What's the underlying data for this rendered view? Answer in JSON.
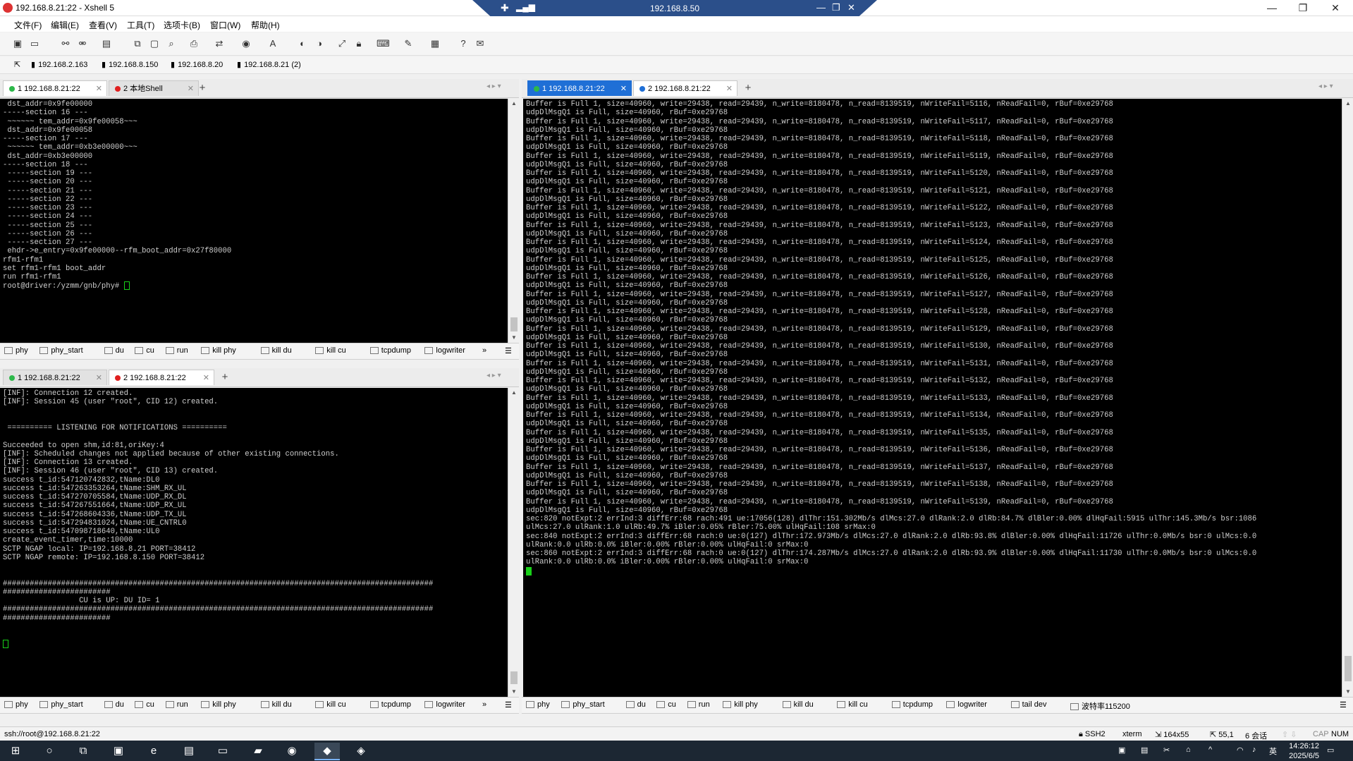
{
  "window": {
    "title": "192.168.8.21:22 - Xshell 5",
    "controls": [
      "—",
      "❐",
      "✕"
    ]
  },
  "remote_bar": {
    "title": "192.168.8.50",
    "controls": [
      "—",
      "❐",
      "✕"
    ]
  },
  "menu": [
    "文件(F)",
    "编辑(E)",
    "查看(V)",
    "工具(T)",
    "选项卡(B)",
    "窗口(W)",
    "帮助(H)"
  ],
  "toolbar_icons": [
    "new-session-icon",
    "open-icon",
    "connect-icon",
    "disconnect-icon",
    "properties-icon",
    "copy-icon",
    "paste-icon",
    "find-icon",
    "print-icon",
    "transfer-icon",
    "globe-icon",
    "font-icon",
    "xftp-icon",
    "xmanager-icon",
    "fullscreen-icon",
    "lock-icon",
    "keyboard-icon",
    "compose-icon",
    "layout-icon",
    "help-icon",
    "chat-icon"
  ],
  "bookmarks": [
    "192.168.2.163",
    "192.168.8.150",
    "192.168.8.20",
    "192.168.8.21 (2)"
  ],
  "top_left": {
    "tabs": [
      {
        "label": "1 192.168.8.21:22",
        "dot": "#2db84a"
      },
      {
        "label": "2 本地Shell",
        "dot": "#e02020"
      }
    ],
    "lines": [
      " dst_addr=0x9fe00000",
      "-----section 16 ---",
      " ~~~~~~ tem_addr=0x9fe00058~~~",
      " dst_addr=0x9fe00058",
      "-----section 17 ---",
      " ~~~~~~ tem_addr=0xb3e00000~~~",
      " dst_addr=0xb3e00000",
      "-----section 18 ---",
      " -----section 19 ---",
      " -----section 20 ---",
      " -----section 21 ---",
      " -----section 22 ---",
      " -----section 23 ---",
      " -----section 24 ---",
      " -----section 25 ---",
      " -----section 26 ---",
      " -----section 27 ---",
      " ehdr->e_entry=0x9fe00000--rfm_boot_addr=0x27f80000",
      "rfm1-rfm1",
      "set rfm1-rfm1 boot_addr",
      "run rfm1-rfm1",
      "root@driver:/yzmm/gnb/phy# "
    ]
  },
  "bottom_left": {
    "tabs": [
      {
        "label": "1 192.168.8.21:22",
        "dot": "#2db84a"
      },
      {
        "label": "2 192.168.8.21:22",
        "dot": "#e02020"
      }
    ],
    "lines": [
      "[INF]: Connection 12 created.",
      "[INF]: Session 45 (user \"root\", CID 12) created.",
      "",
      "",
      " ========== LISTENING FOR NOTIFICATIONS ==========",
      "",
      "Succeeded to open shm,id:81,oriKey:4",
      "[INF]: Scheduled changes not applied because of other existing connections.",
      "[INF]: Connection 13 created.",
      "[INF]: Session 46 (user \"root\", CID 13) created.",
      "success t_id:547120742832,tName:DL0",
      "success t_id:547263353264,tName:SHM_RX_UL",
      "success t_id:547270705584,tName:UDP_RX_DL",
      "success t_id:547267551664,tName:UDP_RX_UL",
      "success t_id:547268604336,tName:UDP_TX_UL",
      "success t_id:547294831024,tName:UE_CNTRL0",
      "success t_id:547098718640,tName:UL0",
      "create_event_timer,time:10000",
      "SCTP NGAP local: IP=192.168.8.21 PORT=38412",
      "SCTP NGAP remote: IP=192.168.8.150 PORT=38412",
      "",
      "",
      "################################################################################################",
      "########################",
      "                 CU is UP: DU ID= 1",
      "################################################################################################",
      "########################",
      "",
      ""
    ]
  },
  "right": {
    "tabs": [
      {
        "label": "1 192.168.8.21:22",
        "dot": "#2db84a"
      },
      {
        "label": "2 192.168.8.21:22",
        "dot": "#1f6fd6"
      }
    ],
    "lines": [
      "Buffer is Full 1, size=40960, write=29438, read=29439, n_write=8180478, n_read=8139519, nWriteFail=5116, nReadFail=0, rBuf=0xe29768",
      "udpDlMsgQ1 is Full, size=40960, rBuf=0xe29768",
      "Buffer is Full 1, size=40960, write=29438, read=29439, n_write=8180478, n_read=8139519, nWriteFail=5117, nReadFail=0, rBuf=0xe29768",
      "udpDlMsgQ1 is Full, size=40960, rBuf=0xe29768",
      "Buffer is Full 1, size=40960, write=29438, read=29439, n_write=8180478, n_read=8139519, nWriteFail=5118, nReadFail=0, rBuf=0xe29768",
      "udpDlMsgQ1 is Full, size=40960, rBuf=0xe29768",
      "Buffer is Full 1, size=40960, write=29438, read=29439, n_write=8180478, n_read=8139519, nWriteFail=5119, nReadFail=0, rBuf=0xe29768",
      "udpDlMsgQ1 is Full, size=40960, rBuf=0xe29768",
      "Buffer is Full 1, size=40960, write=29438, read=29439, n_write=8180478, n_read=8139519, nWriteFail=5120, nReadFail=0, rBuf=0xe29768",
      "udpDlMsgQ1 is Full, size=40960, rBuf=0xe29768",
      "Buffer is Full 1, size=40960, write=29438, read=29439, n_write=8180478, n_read=8139519, nWriteFail=5121, nReadFail=0, rBuf=0xe29768",
      "udpDlMsgQ1 is Full, size=40960, rBuf=0xe29768",
      "Buffer is Full 1, size=40960, write=29438, read=29439, n_write=8180478, n_read=8139519, nWriteFail=5122, nReadFail=0, rBuf=0xe29768",
      "udpDlMsgQ1 is Full, size=40960, rBuf=0xe29768",
      "Buffer is Full 1, size=40960, write=29438, read=29439, n_write=8180478, n_read=8139519, nWriteFail=5123, nReadFail=0, rBuf=0xe29768",
      "udpDlMsgQ1 is Full, size=40960, rBuf=0xe29768",
      "Buffer is Full 1, size=40960, write=29438, read=29439, n_write=8180478, n_read=8139519, nWriteFail=5124, nReadFail=0, rBuf=0xe29768",
      "udpDlMsgQ1 is Full, size=40960, rBuf=0xe29768",
      "Buffer is Full 1, size=40960, write=29438, read=29439, n_write=8180478, n_read=8139519, nWriteFail=5125, nReadFail=0, rBuf=0xe29768",
      "udpDlMsgQ1 is Full, size=40960, rBuf=0xe29768",
      "Buffer is Full 1, size=40960, write=29438, read=29439, n_write=8180478, n_read=8139519, nWriteFail=5126, nReadFail=0, rBuf=0xe29768",
      "udpDlMsgQ1 is Full, size=40960, rBuf=0xe29768",
      "Buffer is Full 1, size=40960, write=29438, read=29439, n_write=8180478, n_read=8139519, nWriteFail=5127, nReadFail=0, rBuf=0xe29768",
      "udpDlMsgQ1 is Full, size=40960, rBuf=0xe29768",
      "Buffer is Full 1, size=40960, write=29438, read=29439, n_write=8180478, n_read=8139519, nWriteFail=5128, nReadFail=0, rBuf=0xe29768",
      "udpDlMsgQ1 is Full, size=40960, rBuf=0xe29768",
      "Buffer is Full 1, size=40960, write=29438, read=29439, n_write=8180478, n_read=8139519, nWriteFail=5129, nReadFail=0, rBuf=0xe29768",
      "udpDlMsgQ1 is Full, size=40960, rBuf=0xe29768",
      "Buffer is Full 1, size=40960, write=29438, read=29439, n_write=8180478, n_read=8139519, nWriteFail=5130, nReadFail=0, rBuf=0xe29768",
      "udpDlMsgQ1 is Full, size=40960, rBuf=0xe29768",
      "Buffer is Full 1, size=40960, write=29438, read=29439, n_write=8180478, n_read=8139519, nWriteFail=5131, nReadFail=0, rBuf=0xe29768",
      "udpDlMsgQ1 is Full, size=40960, rBuf=0xe29768",
      "Buffer is Full 1, size=40960, write=29438, read=29439, n_write=8180478, n_read=8139519, nWriteFail=5132, nReadFail=0, rBuf=0xe29768",
      "udpDlMsgQ1 is Full, size=40960, rBuf=0xe29768",
      "Buffer is Full 1, size=40960, write=29438, read=29439, n_write=8180478, n_read=8139519, nWriteFail=5133, nReadFail=0, rBuf=0xe29768",
      "udpDlMsgQ1 is Full, size=40960, rBuf=0xe29768",
      "Buffer is Full 1, size=40960, write=29438, read=29439, n_write=8180478, n_read=8139519, nWriteFail=5134, nReadFail=0, rBuf=0xe29768",
      "udpDlMsgQ1 is Full, size=40960, rBuf=0xe29768",
      "Buffer is Full 1, size=40960, write=29438, read=29439, n_write=8180478, n_read=8139519, nWriteFail=5135, nReadFail=0, rBuf=0xe29768",
      "udpDlMsgQ1 is Full, size=40960, rBuf=0xe29768",
      "Buffer is Full 1, size=40960, write=29438, read=29439, n_write=8180478, n_read=8139519, nWriteFail=5136, nReadFail=0, rBuf=0xe29768",
      "udpDlMsgQ1 is Full, size=40960, rBuf=0xe29768",
      "Buffer is Full 1, size=40960, write=29438, read=29439, n_write=8180478, n_read=8139519, nWriteFail=5137, nReadFail=0, rBuf=0xe29768",
      "udpDlMsgQ1 is Full, size=40960, rBuf=0xe29768",
      "Buffer is Full 1, size=40960, write=29438, read=29439, n_write=8180478, n_read=8139519, nWriteFail=5138, nReadFail=0, rBuf=0xe29768",
      "udpDlMsgQ1 is Full, size=40960, rBuf=0xe29768",
      "Buffer is Full 1, size=40960, write=29438, read=29439, n_write=8180478, n_read=8139519, nWriteFail=5139, nReadFail=0, rBuf=0xe29768",
      "udpDlMsgQ1 is Full, size=40960, rBuf=0xe29768",
      "sec:820 notExpt:2 errInd:3 diffErr:68 rach:491 ue:17056(128) dlThr:151.302Mb/s dlMcs:27.0 dlRank:2.0 dlRb:84.7% dlBler:0.00% dlHqFail:5915 ulThr:145.3Mb/s bsr:1086",
      "ulMcs:27.0 ulRank:1.0 ulRb:49.7% iBler:0.05% rBler:75.00% ulHqFail:108 srMax:0",
      "sec:840 notExpt:2 errInd:3 diffErr:68 rach:0 ue:0(127) dlThr:172.973Mb/s dlMcs:27.0 dlRank:2.0 dlRb:93.8% dlBler:0.00% dlHqFail:11726 ulThr:0.0Mb/s bsr:0 ulMcs:0.0",
      "ulRank:0.0 ulRb:0.0% iBler:0.00% rBler:0.00% ulHqFail:0 srMax:0",
      "sec:860 notExpt:2 errInd:3 diffErr:68 rach:0 ue:0(127) dlThr:174.287Mb/s dlMcs:27.0 dlRank:2.0 dlRb:93.9% dlBler:0.00% dlHqFail:11730 ulThr:0.0Mb/s bsr:0 ulMcs:0.0",
      "ulRank:0.0 ulRb:0.0% iBler:0.00% rBler:0.00% ulHqFail:0 srMax:0"
    ]
  },
  "quick_buttons_left": [
    "phy",
    "phy_start",
    "du",
    "cu",
    "run",
    "kill phy",
    "kill du",
    "kill cu",
    "tcpdump",
    "logwriter"
  ],
  "quick_buttons_right": [
    "phy",
    "phy_start",
    "du",
    "cu",
    "run",
    "kill phy",
    "kill du",
    "kill cu",
    "tcpdump",
    "logwriter",
    "tail dev",
    "波特率115200"
  ],
  "status": {
    "path": "ssh://root@192.168.8.21:22",
    "protocol": "SSH2",
    "term": "xterm",
    "size": "164x55",
    "pos": "55,1",
    "sessions": "6 会话",
    "cap": "CAP",
    "num": "NUM"
  },
  "taskbar": {
    "time": "14:26:12",
    "date": "2025/6/5",
    "ime": "英"
  }
}
